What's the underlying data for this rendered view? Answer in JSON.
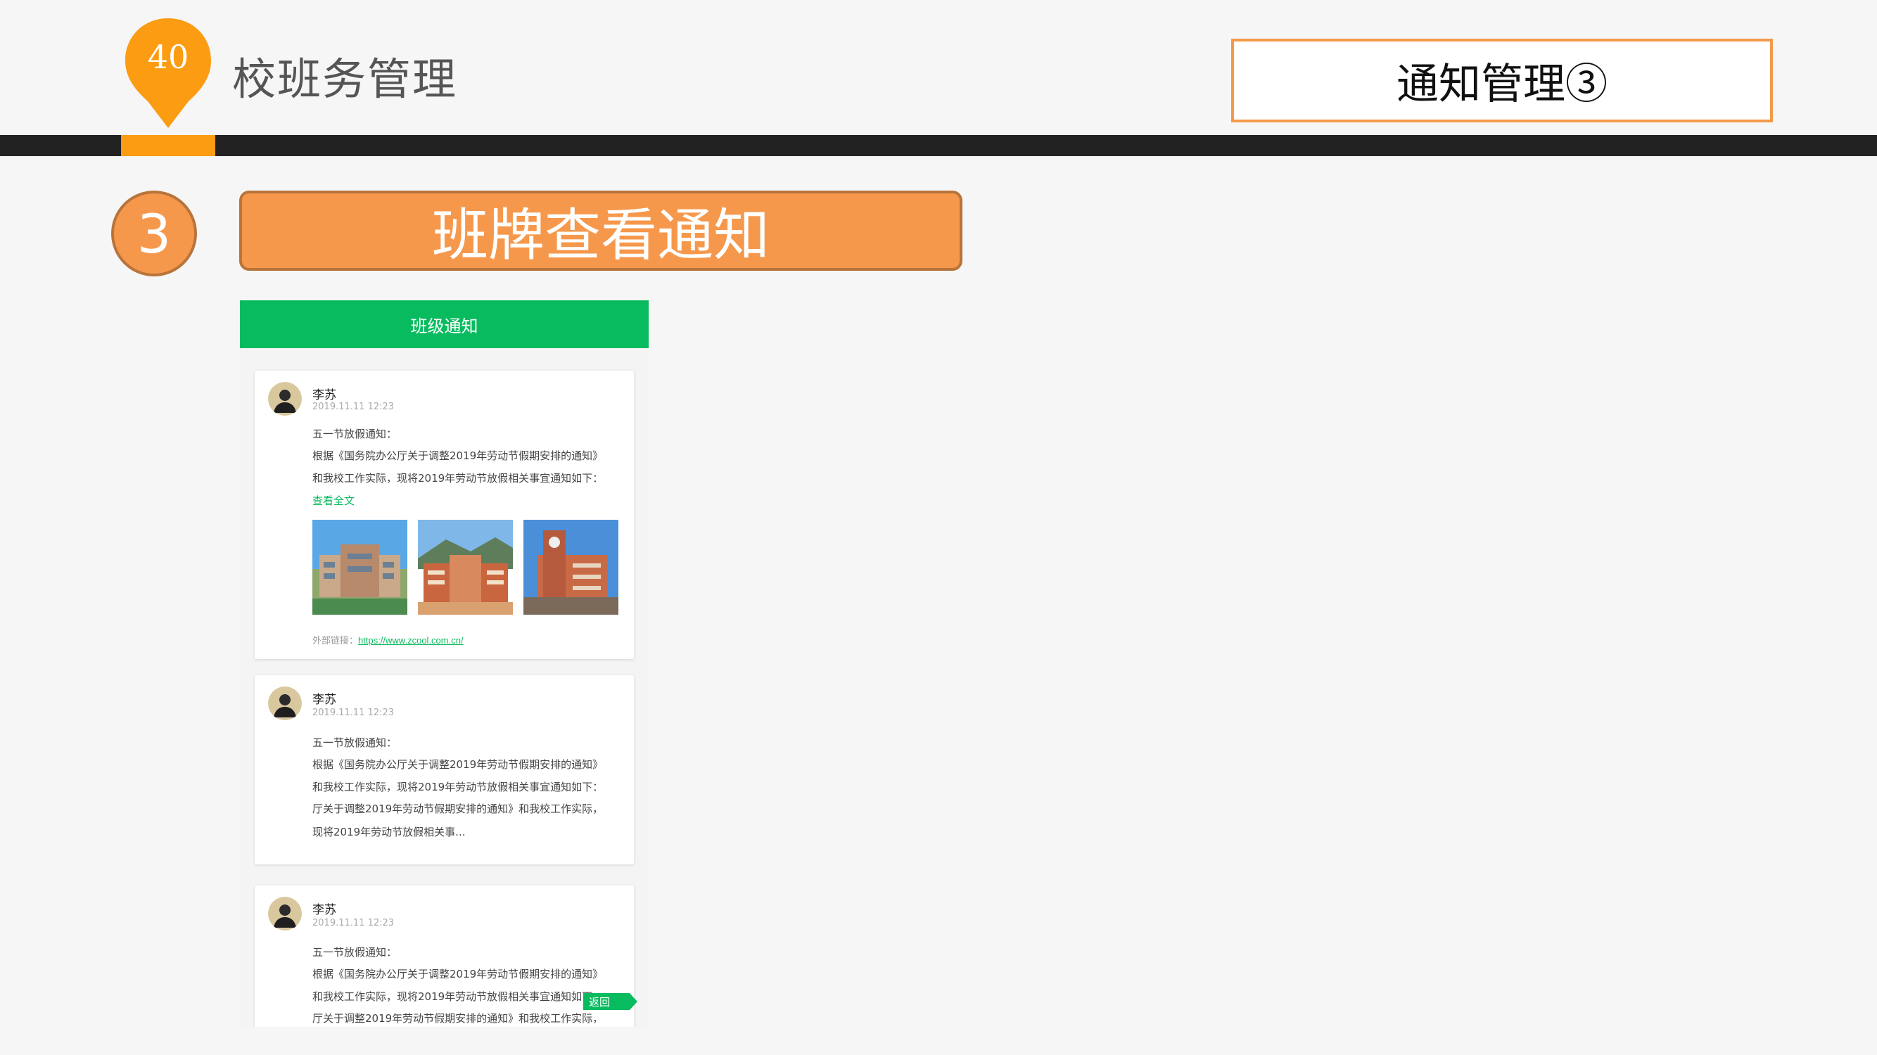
{
  "header": {
    "page_number": "40",
    "section_title": "校班务管理",
    "slide_title": "通知管理③"
  },
  "step": {
    "number": "3",
    "title": "班牌查看通知"
  },
  "phone": {
    "header_title": "班级通知",
    "back_label": "返回",
    "notices": [
      {
        "author": "李苏",
        "time": "2019.11.11  12:23",
        "lines": [
          "五一节放假通知：",
          "根据《国务院办公厅关于调整2019年劳动节假期安排的通知》",
          "和我校工作实际，现将2019年劳动节放假相关事宜通知如下："
        ],
        "more_label": "查看全文",
        "external_label": "外部链接：",
        "external_url": "https://www.zcool.com.cn/"
      },
      {
        "author": "李苏",
        "time": "2019.11.11  12:23",
        "lines": [
          "五一节放假通知：",
          "根据《国务院办公厅关于调整2019年劳动节假期安排的通知》",
          "和我校工作实际，现将2019年劳动节放假相关事宜通知如下：",
          "厅关于调整2019年劳动节假期安排的通知》和我校工作实际，",
          "现将2019年劳动节放假相关事..."
        ]
      },
      {
        "author": "李苏",
        "time": "2019.11.11  12:23",
        "lines": [
          "五一节放假通知：",
          "根据《国务院办公厅关于调整2019年劳动节假期安排的通知》",
          "和我校工作实际，现将2019年劳动节放假相关事宜通知如下：",
          "厅关于调整2019年劳动节假期安排的通知》和我校工作实际，"
        ]
      }
    ]
  },
  "colors": {
    "accent_orange": "#f6984c",
    "pin_orange": "#fb9c12",
    "header_green": "#09bb5f",
    "dark_bar": "#222222"
  }
}
